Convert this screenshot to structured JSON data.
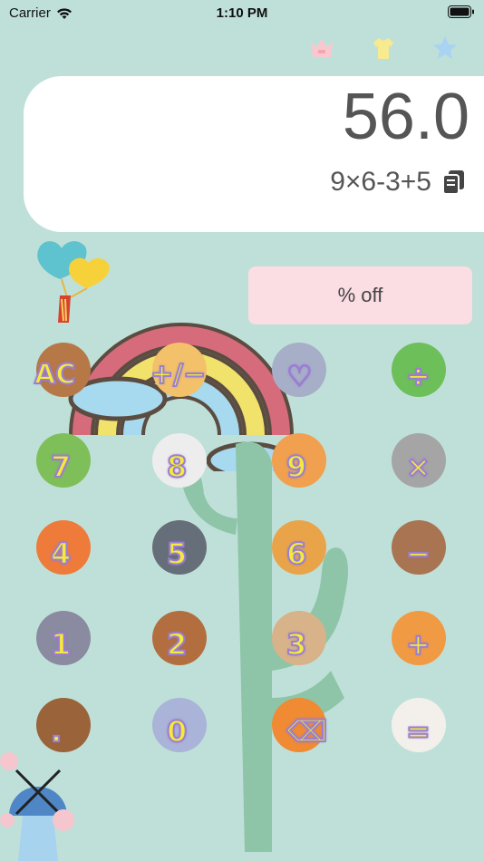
{
  "status": {
    "carrier": "Carrier",
    "time": "1:10 PM"
  },
  "top_icons": [
    {
      "name": "crown-icon",
      "color": "#f9c8cf"
    },
    {
      "name": "shirt-icon",
      "color": "#f7ea8f"
    },
    {
      "name": "star-icon",
      "color": "#a9d3f2"
    }
  ],
  "display": {
    "result": "56.0",
    "expression": "9×6-3+5"
  },
  "promo": {
    "label": "% off"
  },
  "keys": [
    {
      "label": "AC",
      "animal": "dog",
      "color": "#b77847"
    },
    {
      "label": "+/−",
      "animal": "chick",
      "color": "#f2c16a"
    },
    {
      "label": "♡",
      "animal": "elephant",
      "color": "#a7aec7"
    },
    {
      "label": "÷",
      "animal": "frog",
      "color": "#6dbf5a"
    },
    {
      "label": "7",
      "animal": "dinosaur",
      "color": "#7fbf59"
    },
    {
      "label": "8",
      "animal": "panda",
      "color": "#ededed"
    },
    {
      "label": "9",
      "animal": "corgi",
      "color": "#f0a04e"
    },
    {
      "label": "×",
      "animal": "koala",
      "color": "#a5a5a5"
    },
    {
      "label": "4",
      "animal": "fox",
      "color": "#ee7b3a"
    },
    {
      "label": "5",
      "animal": "penguin",
      "color": "#666e7a"
    },
    {
      "label": "6",
      "animal": "lion",
      "color": "#e9a44a"
    },
    {
      "label": "−",
      "animal": "sloth",
      "color": "#a97452"
    },
    {
      "label": "1",
      "animal": "donkey",
      "color": "#8a8aa0"
    },
    {
      "label": "2",
      "animal": "beaver",
      "color": "#b26e3f"
    },
    {
      "label": "3",
      "animal": "puppy",
      "color": "#d8b288"
    },
    {
      "label": "+",
      "animal": "cat",
      "color": "#f19a44"
    },
    {
      "label": ".",
      "animal": "bear",
      "color": "#9a6339"
    },
    {
      "label": "0",
      "animal": "hippo",
      "color": "#aab3d8"
    },
    {
      "label": "⌫",
      "animal": "tiger",
      "color": "#f08a33"
    },
    {
      "label": "=",
      "animal": "cow",
      "color": "#f3f0ec"
    }
  ]
}
